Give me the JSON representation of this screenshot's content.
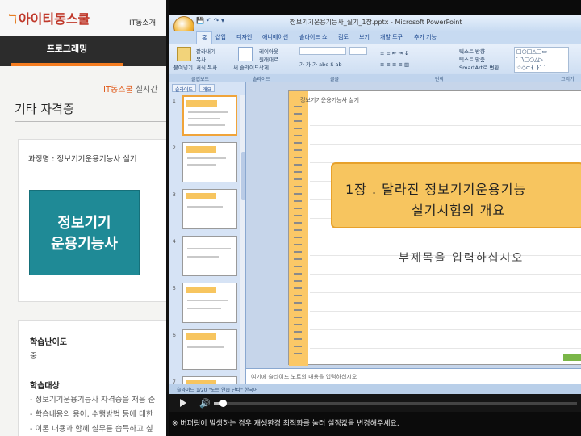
{
  "website": {
    "logo_text": "아이티동스쿨",
    "top_link": "IT동소개",
    "nav_tab": "프로그래밍",
    "breadcrumb_brand": "IT동스쿨",
    "breadcrumb_rest": " 실시간",
    "page_title": "기타 자격증",
    "course_label": "과정명 : 정보기기운용기능사 실기",
    "thumbnail_line1": "정보기기",
    "thumbnail_line2": "운용기능사",
    "difficulty_label": "학습난이도",
    "difficulty_value": "중",
    "target_label": "학습대상",
    "target_items": [
      "- 정보기기운용기능사 자격증을 처음 준",
      "- 학습내용의 용어, 수행방법 등에 대한",
      "- 이론 내용과 함께 실무를 습득하고 싶"
    ]
  },
  "powerpoint": {
    "window_title": "정보기기운용기능사_실기_1장.pptx - Microsoft PowerPoint",
    "tabs": [
      "홈",
      "삽입",
      "디자인",
      "애니메이션",
      "슬라이드 쇼",
      "검토",
      "보기",
      "개발 도구",
      "추가 기능"
    ],
    "selected_tab": "홈",
    "ribbon_buttons": {
      "paste": "붙여넣기",
      "cut": "잘라내기",
      "copy": "복사",
      "format_painter": "서식 복사",
      "new_slide": "새 슬라이드",
      "layout": "레이아웃",
      "reset": "원래대로",
      "delete": "삭제",
      "text_direction": "텍스트 방향",
      "align_text": "텍스트 맞춤",
      "smartart": "SmartArt로 변환"
    },
    "shapes_grid": "□○□△□▭\n⌒\\□○△▷\n☆◇⊂{ }⌒",
    "group_labels": [
      "클립보드",
      "슬라이드",
      "글꼴",
      "단락",
      "그리기"
    ],
    "panel_tabs": [
      "슬라이드",
      "개요"
    ],
    "slide_numbers": [
      "1",
      "2",
      "3",
      "4",
      "5",
      "6",
      "7"
    ],
    "slide_header": "정보기기운용기능사 실기",
    "slide_title_line1": "1장 . 달라진 정보기기운용기능",
    "slide_title_line2": "실기시험의 개요",
    "slide_subtitle": "부제목을 입력하십시오",
    "notes_placeholder": "여기에 슬라이드 노트의 내용을 입력하십시오",
    "status_text": "슬라이드 1/20   \"노트 연습 단타\"   한국어",
    "accent_color": "#f7c55f"
  },
  "player": {
    "progress": 0.02,
    "notice": "※ 버퍼링이 발생하는 경우 재생환경 최적화를 눌러 설정값을 변경해주세요."
  }
}
